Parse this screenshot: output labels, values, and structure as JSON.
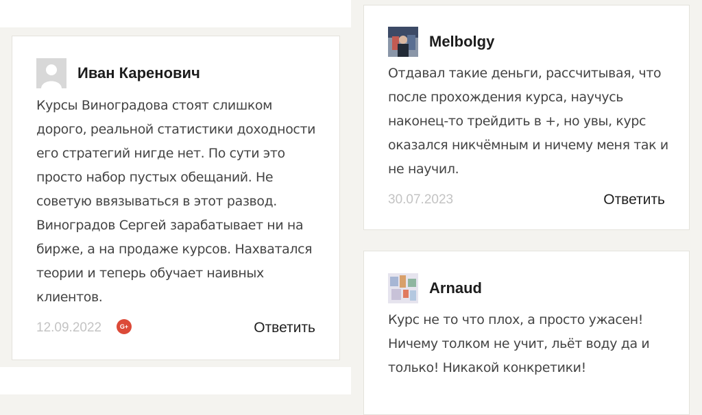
{
  "comments": [
    {
      "author": "Иван Каренович",
      "avatar": "default-user-avatar",
      "lines": [
        "Курсы Виноградова стоят слишком",
        "дорого, реальной статистики доходности",
        "его стратегий нигде нет. По сути это",
        "просто набор пустых обещаний. Не",
        "советую ввязываться в этот развод.",
        "Виноградов Сергей зарабатывает ни на",
        "бирже, а на продаже курсов. Нахватался",
        "теории и теперь обучает наивных",
        "клиентов."
      ],
      "date": "12.09.2022",
      "social_icon": "google-plus-icon",
      "social_label": "G+",
      "reply_label": "Ответить"
    },
    {
      "author": "Melbolgy",
      "avatar": "photo-avatar",
      "lines": [
        "Отдавал такие деньги, рассчитывая, что",
        "после прохождения курса, научусь",
        "наконец-то трейдить в +, но увы, курс",
        "оказался никчёмным и ничему меня так и",
        "не научил."
      ],
      "date": "30.07.2023",
      "reply_label": "Ответить"
    },
    {
      "author": "Arnaud",
      "avatar": "photo-avatar",
      "lines": [
        "Курс не то что плох, а просто ужасен!",
        "Ничему толком не учит, льёт воду да и",
        "только! Никакой конкретики!"
      ]
    }
  ],
  "colors": {
    "background": "#f4f3ef",
    "card": "#ffffff",
    "border": "#e4e2dc",
    "date": "#c3c3c3",
    "google_plus": "#dc4a38"
  }
}
